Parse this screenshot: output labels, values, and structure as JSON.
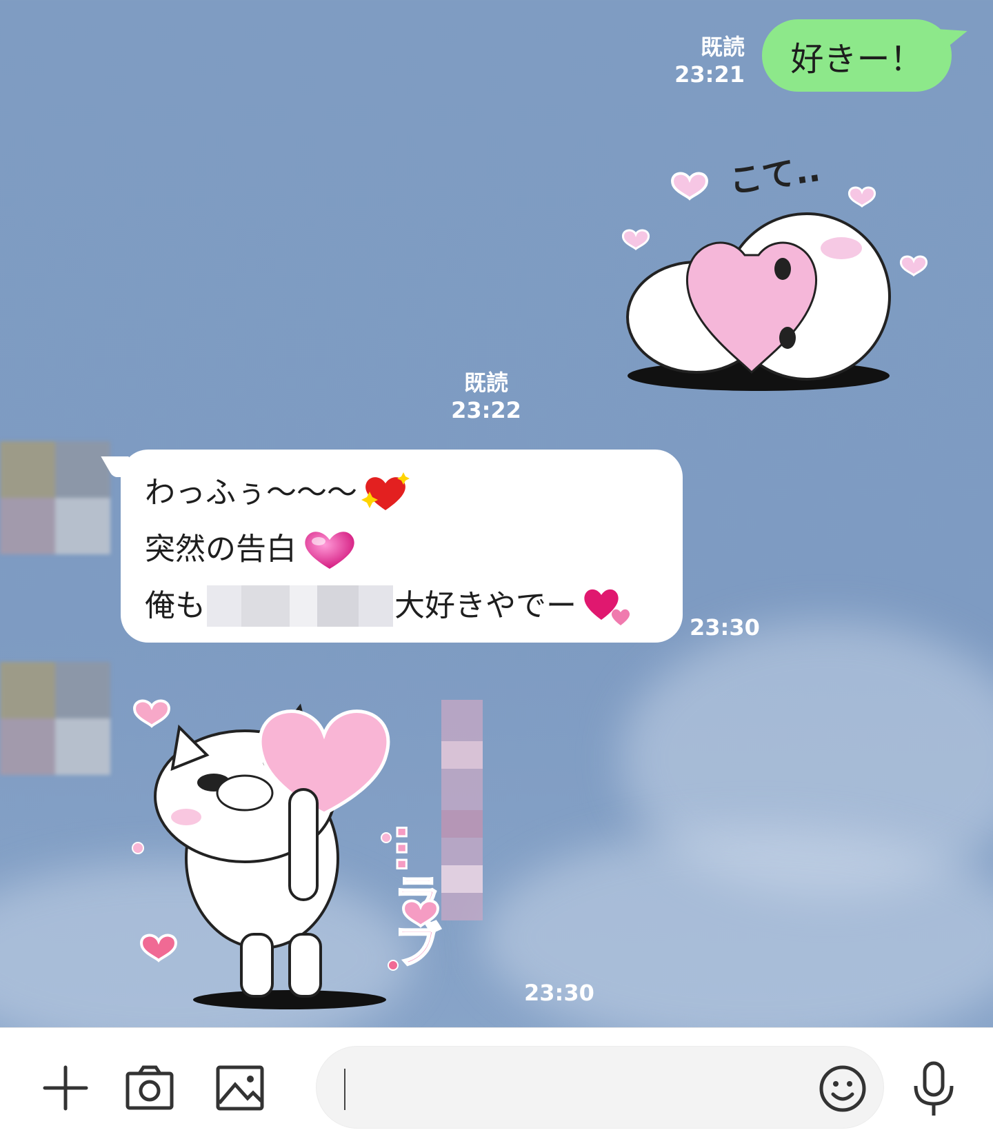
{
  "messages": {
    "m1": {
      "text": "好きー！",
      "read": "既読",
      "time": "23:21"
    },
    "m2": {
      "read": "既読",
      "time": "23:22",
      "sticker": "bunny-hugging-heart-sticker"
    },
    "m3": {
      "lines": [
        "わっふぅ〜〜〜",
        "突然の告白",
        "俺も",
        "大好きやでー"
      ],
      "time": "23:30"
    },
    "m4": {
      "sticker": "cat-holding-heart-sticker",
      "time": "23:30"
    }
  },
  "colors": {
    "sent_bubble": "#8de88a",
    "received_bubble": "#ffffff",
    "background": "#7f9cc2"
  },
  "input": {
    "placeholder": ""
  },
  "icons": [
    "plus-icon",
    "camera-icon",
    "image-icon",
    "emoji-icon",
    "mic-icon"
  ]
}
